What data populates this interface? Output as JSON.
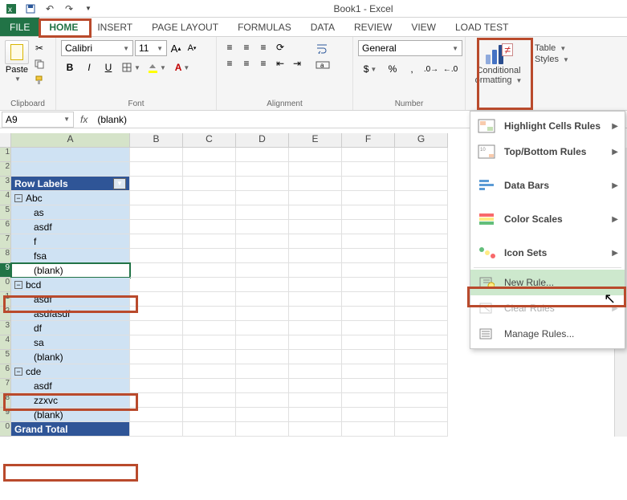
{
  "title": "Book1 - Excel",
  "tabs": {
    "file": "FILE",
    "home": "HOME",
    "insert": "INSERT",
    "page_layout": "PAGE LAYOUT",
    "formulas": "FORMULAS",
    "data": "DATA",
    "review": "REVIEW",
    "view": "VIEW",
    "load_test": "LOAD TEST"
  },
  "ribbon": {
    "clipboard": {
      "label": "Clipboard",
      "paste": "Paste"
    },
    "font": {
      "label": "Font",
      "name": "Calibri",
      "size": "11",
      "bold": "B",
      "italic": "I",
      "underline": "U"
    },
    "alignment": {
      "label": "Alignment"
    },
    "number": {
      "label": "Number",
      "format": "General"
    },
    "styles": {
      "conditional": "Conditional",
      "formatting": "ormatting",
      "table": "Table",
      "styles": "Styles"
    }
  },
  "formula_bar": {
    "cell_ref": "A9",
    "fx": "fx",
    "value": "(blank)"
  },
  "columns": [
    "A",
    "B",
    "C",
    "D",
    "E",
    "F",
    "G"
  ],
  "row_nums": [
    "1",
    "2",
    "3",
    "4",
    "5",
    "6",
    "7",
    "8",
    "9",
    "0",
    "1",
    "2",
    "3",
    "4",
    "5",
    "6",
    "7",
    "8",
    "9",
    "0"
  ],
  "pivot": {
    "header": "Row Labels",
    "abc": "Abc",
    "abc_rows": [
      "as",
      "asdf",
      "f",
      "fsa",
      "(blank)"
    ],
    "bcd": "bcd",
    "bcd_rows": [
      "asdf",
      "asdfasdf",
      "df",
      "sa",
      "(blank)"
    ],
    "cde": "cde",
    "cde_rows": [
      "asdf",
      "zzxvc",
      "(blank)"
    ],
    "grand_total": "Grand Total"
  },
  "cf_menu": {
    "highlight": "Highlight Cells Rules",
    "topbottom": "Top/Bottom Rules",
    "databars": "Data Bars",
    "colorscales": "Color Scales",
    "iconsets": "Icon Sets",
    "newrule": "New Rule...",
    "clearrules": "Clear Rules",
    "managerules": "Manage Rules..."
  }
}
